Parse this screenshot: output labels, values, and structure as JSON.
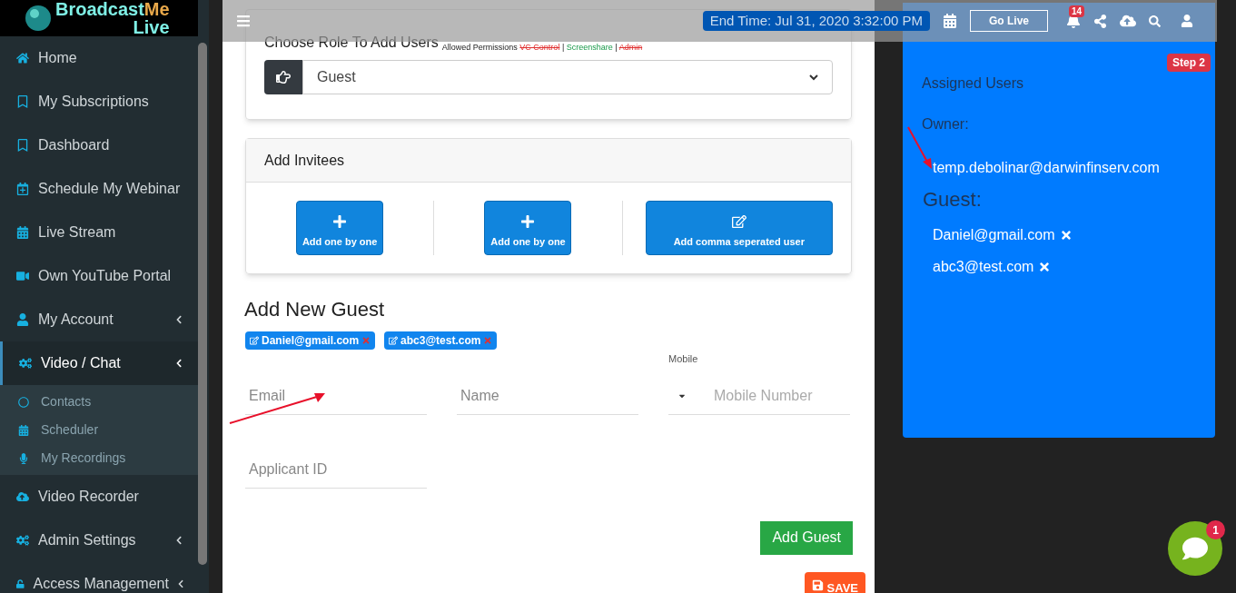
{
  "logo": {
    "brand": "Broadcast",
    "accent": "Me",
    "sub": "Live"
  },
  "sidebar": {
    "items": [
      {
        "label": "Home",
        "selected": false,
        "expandable": false
      },
      {
        "label": "My Subscriptions",
        "selected": false,
        "expandable": false
      },
      {
        "label": "Dashboard",
        "selected": false,
        "expandable": false
      },
      {
        "label": "Schedule My Webinar",
        "selected": false,
        "expandable": false
      },
      {
        "label": "Live Stream",
        "selected": false,
        "expandable": false
      },
      {
        "label": "Own YouTube Portal",
        "selected": false,
        "expandable": false
      },
      {
        "label": "My Account",
        "selected": false,
        "expandable": true
      },
      {
        "label": "Video / Chat",
        "selected": true,
        "expandable": true,
        "children": [
          {
            "label": "Contacts"
          },
          {
            "label": "Scheduler"
          },
          {
            "label": "My Recordings"
          }
        ]
      },
      {
        "label": "Video Recorder",
        "selected": false,
        "expandable": false
      },
      {
        "label": "Admin Settings",
        "selected": false,
        "expandable": true
      },
      {
        "label": "Access Management",
        "selected": false,
        "expandable": true
      }
    ]
  },
  "topbar": {
    "go_live": "Go Live",
    "notifications": "14"
  },
  "role_card": {
    "title": "Choose Role To Add Users",
    "permissions_label": "Allowed Permissions",
    "separator": "|",
    "permissions": [
      {
        "label": "VC Control",
        "allowed": false
      },
      {
        "label": "Screenshare",
        "allowed": true
      },
      {
        "label": "Admin",
        "allowed": false
      }
    ],
    "role": "Guest"
  },
  "invitees_card": {
    "title": "Add Invitees",
    "buttons": [
      {
        "label": "Add one by one",
        "kind": "plus"
      },
      {
        "label": "Add one by one",
        "kind": "plus"
      },
      {
        "label": "Add comma seperated user",
        "kind": "edit"
      }
    ]
  },
  "add_guest": {
    "title": "Add New Guest",
    "tags": [
      "Daniel@gmail.com",
      "abc3@test.com"
    ],
    "email": {
      "placeholder": "Email"
    },
    "name": {
      "placeholder": "Name"
    },
    "mobile": {
      "label": "Mobile",
      "placeholder": "Mobile Number"
    },
    "applicant": {
      "placeholder": "Applicant ID"
    },
    "submit": "Add Guest",
    "save": "SAVE"
  },
  "assigned": {
    "end_time": "End Time: Jul 31, 2020 3:32:00 PM",
    "step": "Step 2",
    "title": "Assigned Users",
    "owner_label": "Owner:",
    "owner": "temp.debolinar@darwinfinserv.com",
    "guest_label": "Guest:",
    "guests": [
      "Daniel@gmail.com",
      "abc3@test.com"
    ]
  },
  "chat": {
    "badge": "1"
  }
}
